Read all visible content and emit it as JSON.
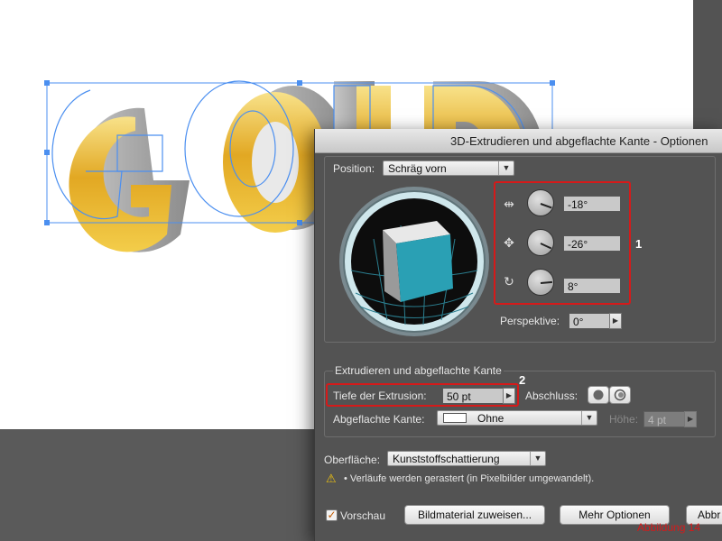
{
  "artwork": {
    "text": "GOLD"
  },
  "dialog": {
    "title": "3D-Extrudieren und abgeflachte Kante - Optionen",
    "position": {
      "label": "Position:",
      "value": "Schräg vorn",
      "rot_x": "-18°",
      "rot_y": "-26°",
      "rot_z": "8°",
      "perspective_label": "Perspektive:",
      "perspective_value": "0°"
    },
    "extrude": {
      "section_label": "Extrudieren und abgeflachte Kante",
      "depth_label": "Tiefe der Extrusion:",
      "depth_value": "50 pt",
      "cap_label": "Abschluss:",
      "bevel_label": "Abgeflachte Kante:",
      "bevel_value": "Ohne",
      "height_label": "Höhe:",
      "height_value": "4 pt"
    },
    "surface": {
      "label": "Oberfläche:",
      "value": "Kunststoffschattierung",
      "warning": "• Verläufe werden gerastert (in Pixelbilder umgewandelt)."
    },
    "footer": {
      "preview_label": "Vorschau",
      "map_art": "Bildmaterial zuweisen...",
      "more_options": "Mehr Optionen",
      "cancel": "Abbr"
    }
  },
  "annotations": {
    "one": "1",
    "two": "2"
  },
  "caption": "Abbildung 14",
  "colors": {
    "highlight": "#d51a1a",
    "cube_front": "#2aa0b4",
    "gold": "#e2a823"
  }
}
